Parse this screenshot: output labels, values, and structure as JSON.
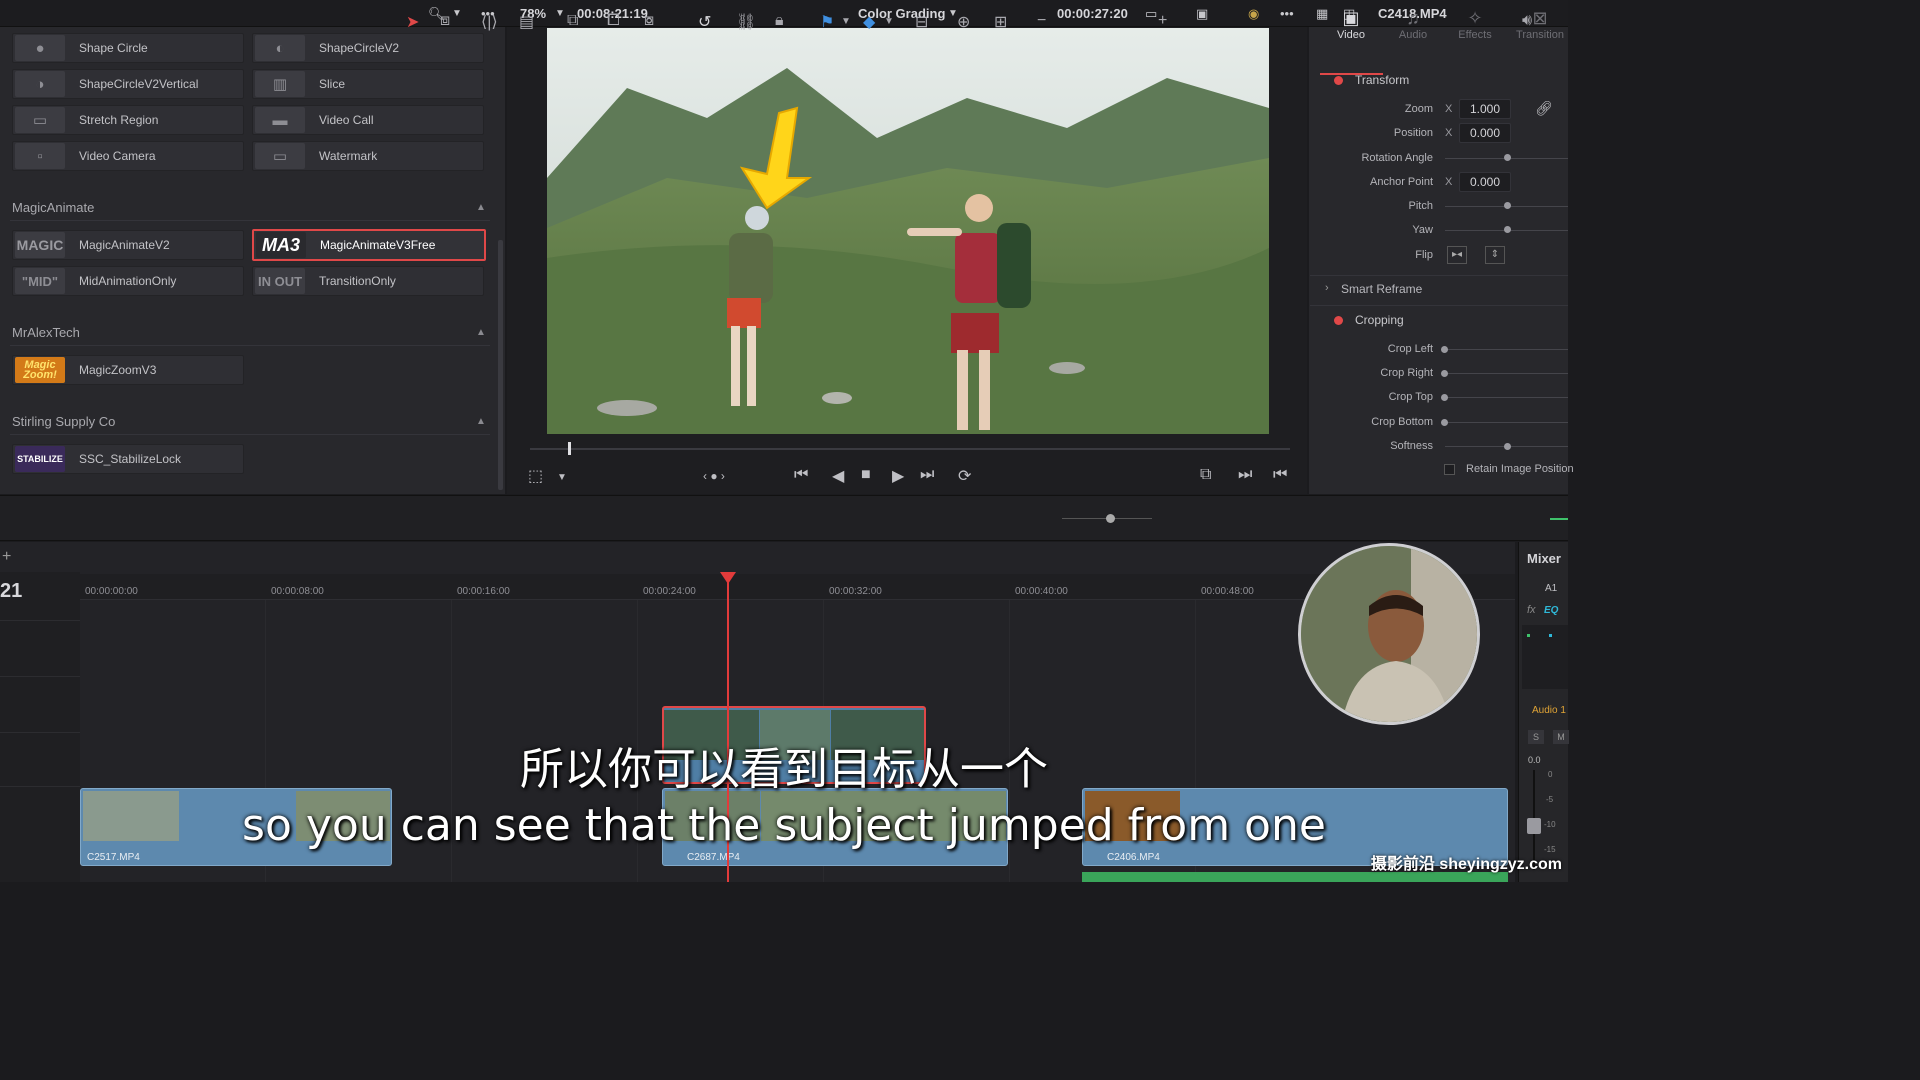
{
  "topbar": {
    "zoom": "78%",
    "timecode_left": "00:08:21:19",
    "page": "Color Grading",
    "timecode_right": "00:00:27:20",
    "clip_name": "C2418.MP4"
  },
  "effects": {
    "items_top": [
      {
        "label": "Shape Circle",
        "thumb": "●"
      },
      {
        "label": "ShapeCircleV2",
        "thumb": "◐"
      },
      {
        "label": "ShapeCircleV2Vertical",
        "thumb": "◑"
      },
      {
        "label": "Slice",
        "thumb": "▥"
      },
      {
        "label": "Stretch Region",
        "thumb": "▭"
      },
      {
        "label": "Video Call",
        "thumb": "▬"
      },
      {
        "label": "Video Camera",
        "thumb": "▫"
      },
      {
        "label": "Watermark",
        "thumb": "▭"
      }
    ],
    "groups": [
      {
        "name": "MagicAnimate"
      },
      {
        "name": "MrAlexTech"
      },
      {
        "name": "Stirling Supply Co"
      }
    ],
    "magic_items": [
      {
        "label": "MagicAnimateV2",
        "thumb": "MAGIC"
      },
      {
        "label": "MagicAnimateV3Free",
        "thumb": "MA3"
      },
      {
        "label": "MidAnimationOnly",
        "thumb": "\"MID\""
      },
      {
        "label": "TransitionOnly",
        "thumb": "IN OUT"
      }
    ],
    "alex_items": [
      {
        "label": "MagicZoomV3",
        "thumb": "Magic Zoom!"
      }
    ],
    "stirling_items": [
      {
        "label": "SSC_StabilizeLock",
        "thumb": "STABILIZE"
      }
    ]
  },
  "inspector": {
    "tabs": [
      "Video",
      "Audio",
      "Effects",
      "Transition"
    ],
    "transform_title": "Transform",
    "rows": {
      "zoom": "Zoom",
      "position": "Position",
      "rotation": "Rotation Angle",
      "anchor": "Anchor Point",
      "pitch": "Pitch",
      "yaw": "Yaw",
      "flip": "Flip"
    },
    "x_label": "X",
    "values": {
      "zoom_x": "1.000",
      "position_x": "0.000",
      "anchor_x": "0.000"
    },
    "smart_reframe": "Smart Reframe",
    "cropping_title": "Cropping",
    "crop_rows": [
      "Crop Left",
      "Crop Right",
      "Crop Top",
      "Crop Bottom",
      "Softness"
    ],
    "retain": "Retain Image Position"
  },
  "timeline": {
    "track_number": "21",
    "timecodes": [
      "00:00:00:00",
      "00:00:08:00",
      "00:00:16:00",
      "00:00:24:00",
      "00:00:32:00",
      "00:00:40:00",
      "00:00:48:00"
    ],
    "clips": [
      "C2517.MP4",
      "C2687.MP4",
      "C2406.MP4"
    ]
  },
  "mixer": {
    "title": "Mixer",
    "a1": "A1",
    "audio": "Audio 1",
    "s": "S",
    "m": "M",
    "db": [
      "0.0",
      "0",
      "-5",
      "-10",
      "-15"
    ],
    "fx": "fx",
    "eq": "EQ"
  },
  "subtitles": {
    "cn": "所以你可以看到目标从一个",
    "en": "so you can see that the subject jumped from one"
  },
  "watermark": "摄影前沿 sheyingzyz.com"
}
